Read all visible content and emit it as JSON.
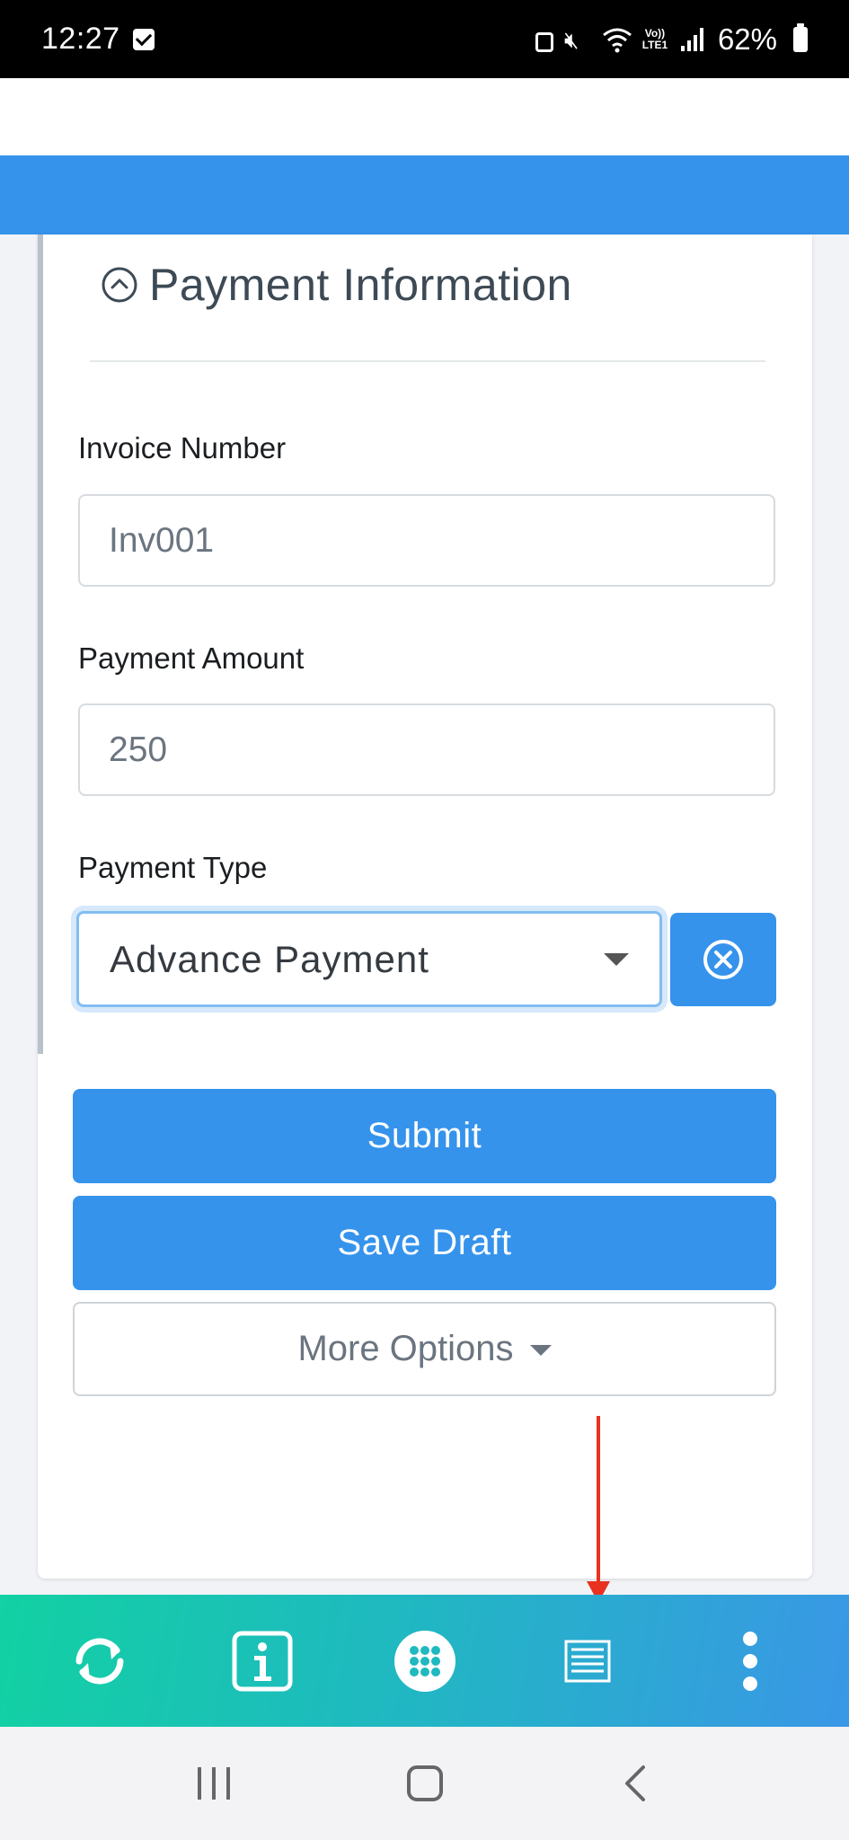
{
  "status_bar": {
    "time": "12:27",
    "volte_top": "Vo))",
    "volte_bottom": "LTE1",
    "battery": "62%"
  },
  "section": {
    "title": "Payment Information"
  },
  "fields": {
    "invoice_label": "Invoice Number",
    "invoice_value": "Inv001",
    "amount_label": "Payment Amount",
    "amount_value": "250",
    "type_label": "Payment Type",
    "type_value": "Advance Payment"
  },
  "buttons": {
    "submit": "Submit",
    "save_draft": "Save Draft",
    "more_options": "More Options"
  },
  "toolbar": {
    "items": [
      "sync-icon",
      "info-icon",
      "apps-grid-icon",
      "list-icon",
      "more-vertical-icon"
    ]
  },
  "colors": {
    "primary": "#3593ec",
    "annotation_arrow": "#e8321f",
    "toolbar_gradient_start": "#12d1a3",
    "toolbar_gradient_end": "#3a97e6"
  }
}
